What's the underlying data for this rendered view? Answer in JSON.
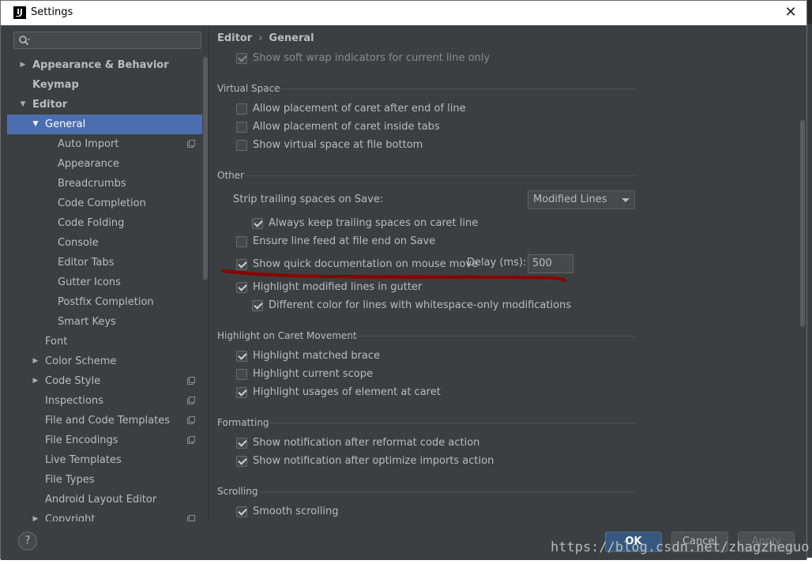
{
  "window": {
    "title": "Settings",
    "icon": "intellij-app-icon",
    "close_symbol": "✕"
  },
  "search": {
    "placeholder": "",
    "value": ""
  },
  "nav": {
    "items": [
      {
        "label": "Appearance & Behavior",
        "arrow": "▶",
        "level": 0,
        "bold": true
      },
      {
        "label": "Keymap",
        "arrow": "",
        "level": 0,
        "bold": true
      },
      {
        "label": "Editor",
        "arrow": "▼",
        "level": 0,
        "bold": true
      },
      {
        "label": "General",
        "arrow": "▼",
        "level": 1,
        "selected": true
      },
      {
        "label": "Auto Import",
        "arrow": "",
        "level": 2,
        "badge": true
      },
      {
        "label": "Appearance",
        "arrow": "",
        "level": 2
      },
      {
        "label": "Breadcrumbs",
        "arrow": "",
        "level": 2
      },
      {
        "label": "Code Completion",
        "arrow": "",
        "level": 2
      },
      {
        "label": "Code Folding",
        "arrow": "",
        "level": 2
      },
      {
        "label": "Console",
        "arrow": "",
        "level": 2
      },
      {
        "label": "Editor Tabs",
        "arrow": "",
        "level": 2
      },
      {
        "label": "Gutter Icons",
        "arrow": "",
        "level": 2
      },
      {
        "label": "Postfix Completion",
        "arrow": "",
        "level": 2
      },
      {
        "label": "Smart Keys",
        "arrow": "",
        "level": 2
      },
      {
        "label": "Font",
        "arrow": "",
        "level": 1
      },
      {
        "label": "Color Scheme",
        "arrow": "▶",
        "level": 1
      },
      {
        "label": "Code Style",
        "arrow": "▶",
        "level": 1,
        "badge": true
      },
      {
        "label": "Inspections",
        "arrow": "",
        "level": 1,
        "badge": true
      },
      {
        "label": "File and Code Templates",
        "arrow": "",
        "level": 1,
        "badge": true
      },
      {
        "label": "File Encodings",
        "arrow": "",
        "level": 1,
        "badge": true
      },
      {
        "label": "Live Templates",
        "arrow": "",
        "level": 1
      },
      {
        "label": "File Types",
        "arrow": "",
        "level": 1
      },
      {
        "label": "Android Layout Editor",
        "arrow": "",
        "level": 1
      },
      {
        "label": "Copyright",
        "arrow": "▶",
        "level": 1,
        "badge": true
      }
    ]
  },
  "breadcrumb": {
    "parent": "Editor",
    "separator": "›",
    "current": "General"
  },
  "settings": {
    "soft_wrap": {
      "label": "Show soft wrap indicators for current line only",
      "checked": true,
      "disabled": true
    },
    "virtual_space": {
      "title": "Virtual Space",
      "items": [
        {
          "label": "Allow placement of caret after end of line",
          "checked": false
        },
        {
          "label": "Allow placement of caret inside tabs",
          "checked": false
        },
        {
          "label": "Show virtual space at file bottom",
          "checked": false
        }
      ]
    },
    "other": {
      "title": "Other",
      "strip_label": "Strip trailing spaces on Save:",
      "strip_value": "Modified Lines",
      "keep_trailing": {
        "label": "Always keep trailing spaces on caret line",
        "checked": true
      },
      "line_feed": {
        "label": "Ensure line feed at file end on Save",
        "checked": false
      },
      "quick_doc": {
        "label": "Show quick documentation on mouse move",
        "checked": true
      },
      "delay_label": "Delay (ms):",
      "delay_value": "500",
      "highlight_modified": {
        "label": "Highlight modified lines in gutter",
        "checked": true
      },
      "whitespace_color": {
        "label": "Different color for lines with whitespace-only modifications",
        "checked": true
      }
    },
    "caret_movement": {
      "title": "Highlight on Caret Movement",
      "items": [
        {
          "label": "Highlight matched brace",
          "checked": true
        },
        {
          "label": "Highlight current scope",
          "checked": false
        },
        {
          "label": "Highlight usages of element at caret",
          "checked": true
        }
      ]
    },
    "formatting": {
      "title": "Formatting",
      "items": [
        {
          "label": "Show notification after reformat code action",
          "checked": true
        },
        {
          "label": "Show notification after optimize imports action",
          "checked": true
        }
      ]
    },
    "scrolling": {
      "title": "Scrolling",
      "items": [
        {
          "label": "Smooth scrolling",
          "checked": true
        }
      ]
    }
  },
  "footer": {
    "help_label": "?",
    "ok_label": "OK",
    "cancel_label": "Cancel",
    "apply_label": "Apply"
  },
  "watermark": "https://blog.csdn.net/zhagzheguo",
  "colors": {
    "background": "#3c3f41",
    "selection": "#4b6eaf",
    "ok_button": "#365880",
    "annotation_stroke": "#8b0000"
  }
}
